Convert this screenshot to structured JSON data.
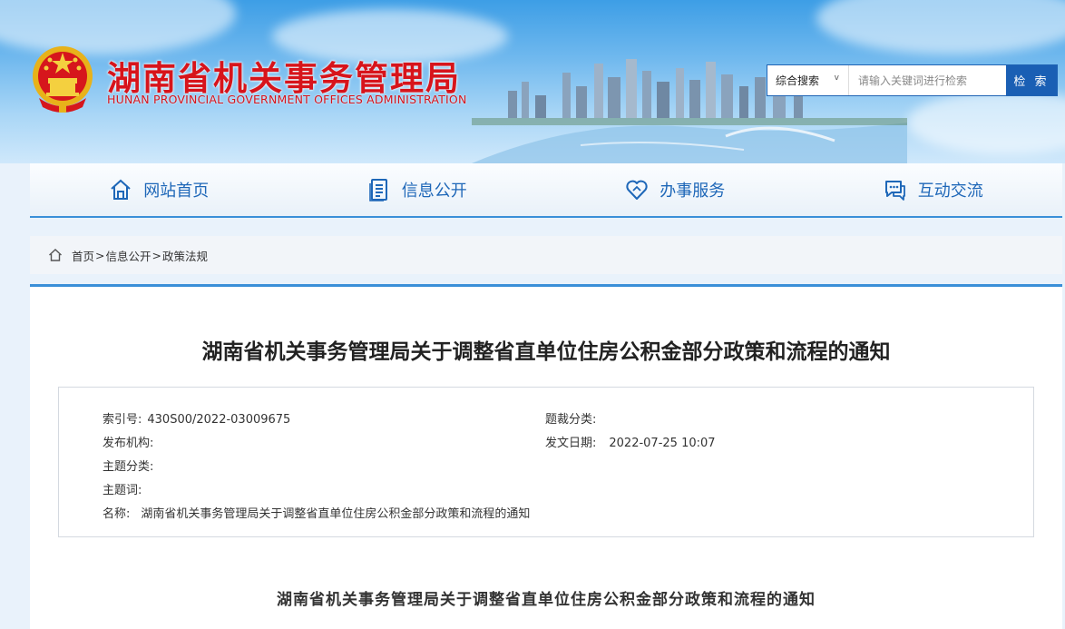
{
  "header": {
    "title": "湖南省机关事务管理局",
    "subtitle": "HUNAN PROVINCIAL GOVERNMENT OFFICES ADMINISTRATION"
  },
  "search": {
    "scope": "综合搜索",
    "placeholder": "请输入关键词进行检索",
    "button": "检 索"
  },
  "nav": {
    "items": [
      {
        "label": "网站首页",
        "icon": "home-icon"
      },
      {
        "label": "信息公开",
        "icon": "document-icon"
      },
      {
        "label": "办事服务",
        "icon": "heart-icon"
      },
      {
        "label": "互动交流",
        "icon": "chat-icon"
      }
    ]
  },
  "breadcrumb": {
    "items": [
      "首页",
      "信息公开",
      "政策法规"
    ],
    "separator": ">"
  },
  "article": {
    "title": "湖南省机关事务管理局关于调整省直单位住房公积金部分政策和流程的通知",
    "body_title": "湖南省机关事务管理局关于调整省直单位住房公积金部分政策和流程的通知"
  },
  "meta": {
    "index_label": "索引号:",
    "index_value": "430S00/2022-03009675",
    "category_label": "题裁分类:",
    "category_value": "",
    "publisher_label": "发布机构:",
    "publisher_value": "",
    "date_label": "发文日期:",
    "date_value": "2022-07-25 10:07",
    "topic_label": "主题分类:",
    "topic_value": "",
    "keywords_label": "主题词:",
    "keywords_value": "",
    "name_label": "名称:",
    "name_value": "湖南省机关事务管理局关于调整省直单位住房公积金部分政策和流程的通知"
  },
  "colors": {
    "brand_red": "#d7141b",
    "nav_blue": "#1e67b8",
    "accent_blue": "#3a8fd8"
  }
}
